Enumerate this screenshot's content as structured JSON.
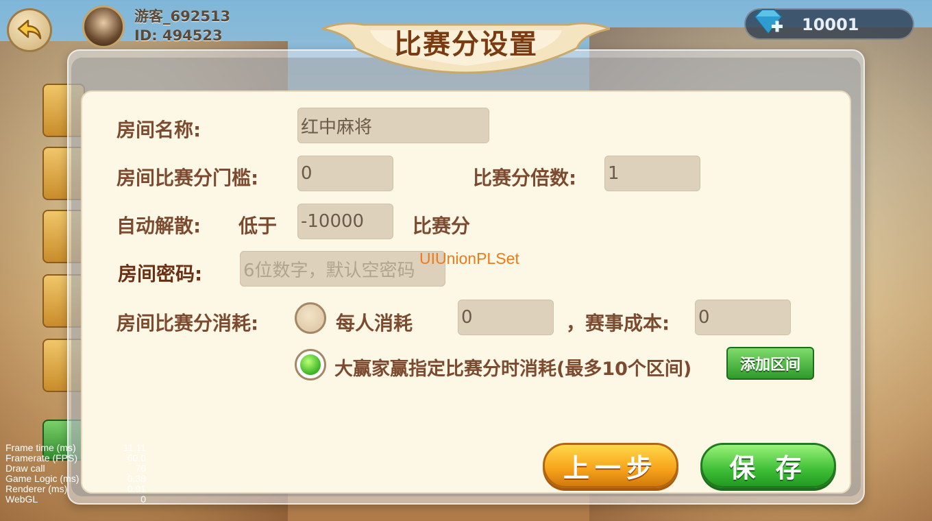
{
  "player": {
    "nickname": "游客_692513",
    "id_text": "ID: 494523"
  },
  "currency": {
    "diamonds": "10001",
    "icon": "diamond-plus-icon"
  },
  "dialog": {
    "title": "比赛分设置",
    "room_name_label": "房间名称:",
    "room_name_value": "红中麻将",
    "threshold_label": "房间比赛分门槛:",
    "threshold_value": "0",
    "multiplier_label": "比赛分倍数:",
    "multiplier_value": "1",
    "auto_dissolve_label": "自动解散:",
    "below_label": "低于",
    "auto_dissolve_value": "-10000",
    "score_unit": "比赛分",
    "password_label": "房间密码:",
    "password_placeholder": "6位数字，默认空密码",
    "consume_label": "房间比赛分消耗:",
    "per_person_label": "每人消耗",
    "per_person_value": "0",
    "cost_label": "，赛事成本:",
    "cost_value": "0",
    "winner_label": "大赢家赢指定比赛分时消耗(最多10个区间)",
    "add_range_label": "添加区间",
    "prev_label": "上一步",
    "save_label": "保 存",
    "selected_option": "winner"
  },
  "watermark": "UIUnionPLSet",
  "debug_stats": [
    {
      "label": "Frame time (ms)",
      "value": "11.11"
    },
    {
      "label": "Framerate (FPS)",
      "value": "60.0"
    },
    {
      "label": "Draw call",
      "value": "76"
    },
    {
      "label": "Game Logic (ms)",
      "value": "0.38"
    },
    {
      "label": "Renderer (ms)",
      "value": "0.91"
    },
    {
      "label": "WebGL",
      "value": "0"
    }
  ],
  "colors": {
    "panel": "#fdf7e6",
    "label": "#7b4a2f",
    "green": "#3fbf37",
    "orange": "#f7a21a"
  }
}
